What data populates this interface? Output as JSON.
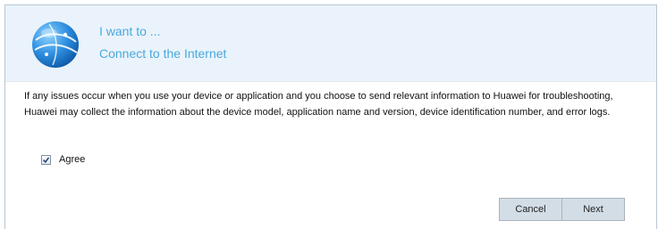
{
  "header": {
    "title": "I want to ...",
    "subtitle": "Connect to the Internet",
    "logo_icon": "globe-icon",
    "background_color": "#eaf3fb",
    "title_color": "#49a9dd"
  },
  "notice": {
    "text": "If any issues occur when you use your device or application and you choose to send relevant information to Huawei for troubleshooting, Huawei may collect the information about the device model, application name and version, device identification number, and error logs."
  },
  "agree": {
    "label": "Agree",
    "checked": true
  },
  "buttons": {
    "cancel_label": "Cancel",
    "next_label": "Next"
  }
}
